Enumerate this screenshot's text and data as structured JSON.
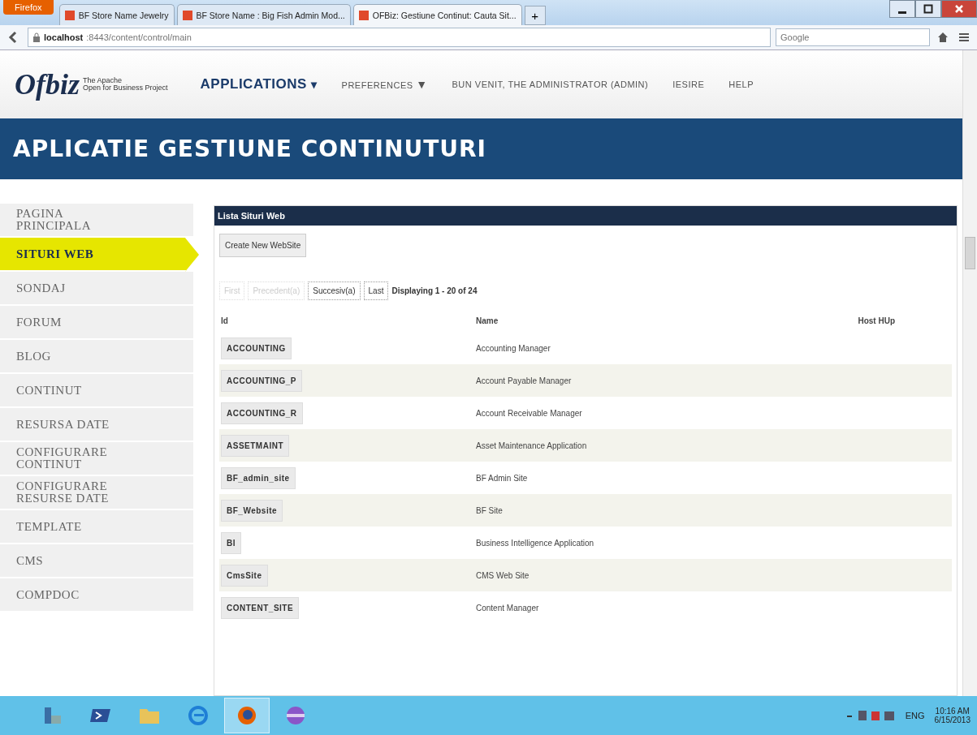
{
  "browser": {
    "menu_button": "Firefox",
    "tabs": [
      {
        "title": "BF Store Name Jewelry",
        "selected": false
      },
      {
        "title": "BF Store Name : Big Fish Admin Mod...",
        "selected": false
      },
      {
        "title": "OFBiz: Gestiune Continut: Cauta Sit...",
        "selected": true
      }
    ],
    "new_tab": "+",
    "url_host": "localhost",
    "url_rest": ":8443/content/control/main",
    "search_placeholder": "Google"
  },
  "header": {
    "logo": "Ofbiz",
    "tagline_1": "The Apache",
    "tagline_2": "Open for Business Project",
    "menu": [
      {
        "label": "APPLICATIONS",
        "caret": "▾",
        "kind": "primary"
      },
      {
        "label": "PREFERENCES",
        "caret": "▼",
        "kind": "dropdown"
      },
      {
        "label": "BUN VENIT, THE ADMINISTRATOR (ADMIN)",
        "kind": "text"
      },
      {
        "label": "IESIRE",
        "kind": "link"
      },
      {
        "label": "HELP",
        "kind": "link"
      }
    ]
  },
  "app_title": "APLICATIE GESTIUNE CONTINUTURI",
  "sidebar": {
    "items": [
      {
        "label": "PAGINA PRINCIPALA",
        "selected": false
      },
      {
        "label": "SITURI WEB",
        "selected": true
      },
      {
        "label": "SONDAJ",
        "selected": false
      },
      {
        "label": "FORUM",
        "selected": false
      },
      {
        "label": "BLOG",
        "selected": false
      },
      {
        "label": "CONTINUT",
        "selected": false
      },
      {
        "label": "RESURSA DATE",
        "selected": false
      },
      {
        "label": "CONFIGURARE CONTINUT",
        "selected": false
      },
      {
        "label": "CONFIGURARE RESURSE DATE",
        "selected": false
      },
      {
        "label": "TEMPLATE",
        "selected": false
      },
      {
        "label": "CMS",
        "selected": false
      },
      {
        "label": "COMPDOC",
        "selected": false
      }
    ]
  },
  "panel": {
    "title": "Lista Situri Web",
    "create_button": "Create New WebSite",
    "pager": [
      {
        "label": "First",
        "disabled": true
      },
      {
        "label": "Precedent(a)",
        "disabled": true
      },
      {
        "label": "Succesiv(a)",
        "disabled": false
      },
      {
        "label": "Last",
        "disabled": false
      }
    ],
    "displaying": "Displaying 1 - 20 of 24",
    "table": {
      "columns": [
        "Id",
        "Name",
        "Host HUp"
      ],
      "rows": [
        {
          "id": "ACCOUNTING",
          "name": "Accounting Manager"
        },
        {
          "id": "ACCOUNTING_P",
          "name": "Account Payable Manager"
        },
        {
          "id": "ACCOUNTING_R",
          "name": "Account Receivable Manager"
        },
        {
          "id": "ASSETMAINT",
          "name": "Asset Maintenance Application"
        },
        {
          "id": "BF_admin_site",
          "name": "BF Admin Site"
        },
        {
          "id": "BF_Website",
          "name": "BF Site"
        },
        {
          "id": "BI",
          "name": "Business Intelligence Application"
        },
        {
          "id": "CmsSite",
          "name": "CMS Web Site"
        },
        {
          "id": "CONTENT_SITE",
          "name": "Content Manager"
        }
      ]
    }
  },
  "taskbar": {
    "language": "ENG",
    "time": "10:16 AM",
    "date": "6/15/2013"
  }
}
